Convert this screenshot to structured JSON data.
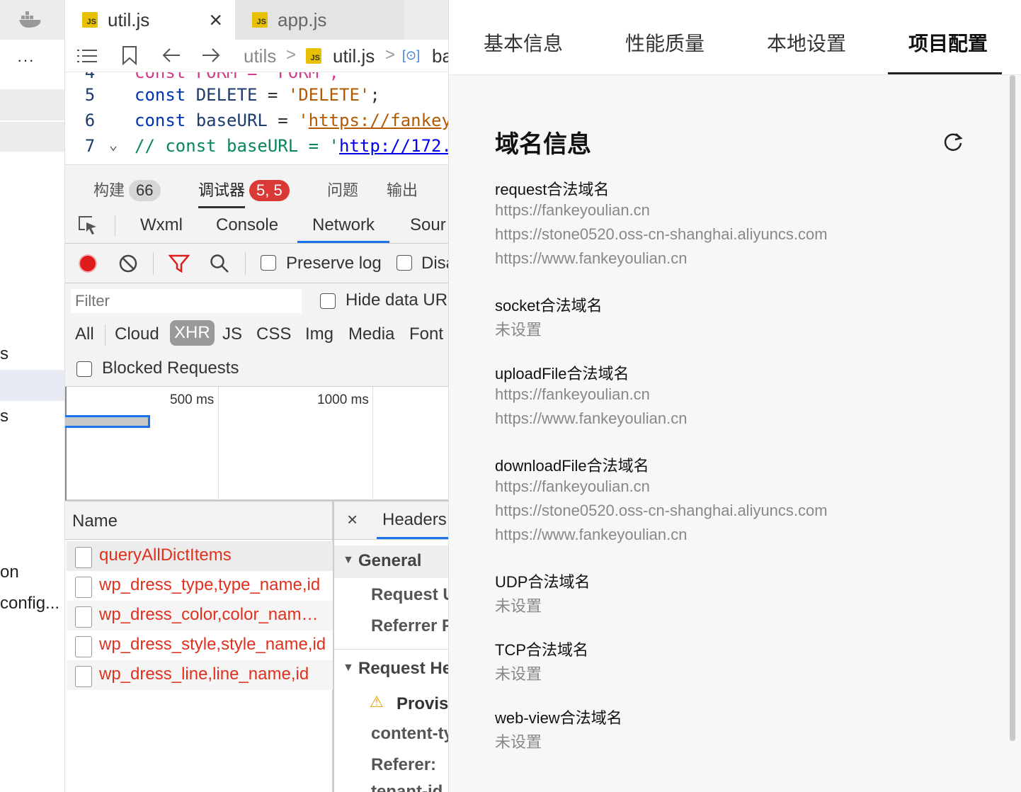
{
  "left_strip": {
    "ellipsis": "···",
    "fragments": [
      "s",
      "s",
      "on",
      "config..."
    ]
  },
  "editor": {
    "tabs": [
      {
        "icon": "JS",
        "label": "util.js",
        "close": "×"
      },
      {
        "icon": "JS",
        "label": "app.js"
      }
    ],
    "breadcrumb": {
      "folder": "utils",
      "sep": ">",
      "file": "util.js",
      "symbol": "ba"
    },
    "lines": [
      {
        "num": "4",
        "text": "const FORM = 'FORM';"
      },
      {
        "num": "5",
        "kw": "const",
        "name": " DELETE ",
        "op": "=",
        "str": " 'DELETE'",
        "end": ";"
      },
      {
        "num": "6",
        "kw": "const",
        "name": " baseURL ",
        "op": "=",
        "str_pre": " '",
        "url": "https://fankey"
      },
      {
        "num": "7",
        "comment": "// const baseURL = '",
        "url": "http://172."
      }
    ]
  },
  "devtools": {
    "top_tabs": [
      {
        "label": "构建",
        "badge": "66"
      },
      {
        "label": "调试器",
        "badge": "5, 5"
      },
      {
        "label": "问题"
      },
      {
        "label": "输出"
      }
    ],
    "panel_tabs": [
      "Wxml",
      "Console",
      "Network",
      "Sour"
    ],
    "active_panel": "Network",
    "toolbar": {
      "preserve_log": "Preserve log",
      "disable": "Disa"
    },
    "filter": {
      "placeholder": "Filter",
      "hide_data_urls": "Hide data UR",
      "types": [
        "All",
        "Cloud",
        "XHR",
        "JS",
        "CSS",
        "Img",
        "Media",
        "Font"
      ],
      "active_type": "XHR",
      "blocked_requests": "Blocked Requests"
    },
    "timeline": {
      "ticks": [
        "500 ms",
        "1000 ms"
      ]
    },
    "requests": {
      "header": "Name",
      "rows": [
        "queryAllDictItems",
        "wp_dress_type,type_name,id",
        "wp_dress_color,color_nam…",
        "wp_dress_style,style_name,id",
        "wp_dress_line,line_name,id"
      ]
    },
    "detail": {
      "close": "×",
      "tab": "Headers",
      "general": "General",
      "request_url": "Request U",
      "referrer_policy": "Referrer F",
      "request_headers": "Request He",
      "provisional": "Provis",
      "content_type": "content-ty",
      "referer": "Referer:",
      "tenant": "tenant-id"
    }
  },
  "project_panel": {
    "tabs": [
      "基本信息",
      "性能质量",
      "本地设置",
      "项目配置"
    ],
    "active_tab": "项目配置",
    "section_title": "域名信息",
    "groups": [
      {
        "label": "request合法域名",
        "values": [
          "https://fankeyoulian.cn",
          "https://stone0520.oss-cn-shanghai.aliyuncs.com",
          "https://www.fankeyoulian.cn"
        ]
      },
      {
        "label": "socket合法域名",
        "values": [
          "未设置"
        ]
      },
      {
        "label": "uploadFile合法域名",
        "values": [
          "https://fankeyoulian.cn",
          "https://www.fankeyoulian.cn"
        ]
      },
      {
        "label": "downloadFile合法域名",
        "values": [
          "https://fankeyoulian.cn",
          "https://stone0520.oss-cn-shanghai.aliyuncs.com",
          "https://www.fankeyoulian.cn"
        ]
      },
      {
        "label": "UDP合法域名",
        "values": [
          "未设置"
        ]
      },
      {
        "label": "TCP合法域名",
        "values": [
          "未设置"
        ]
      },
      {
        "label": "web-view合法域名",
        "values": [
          "未设置"
        ]
      }
    ]
  },
  "colors": {
    "accent_blue": "#1a73e8",
    "error_red": "#e0301e",
    "badge_red": "#d93a35"
  }
}
